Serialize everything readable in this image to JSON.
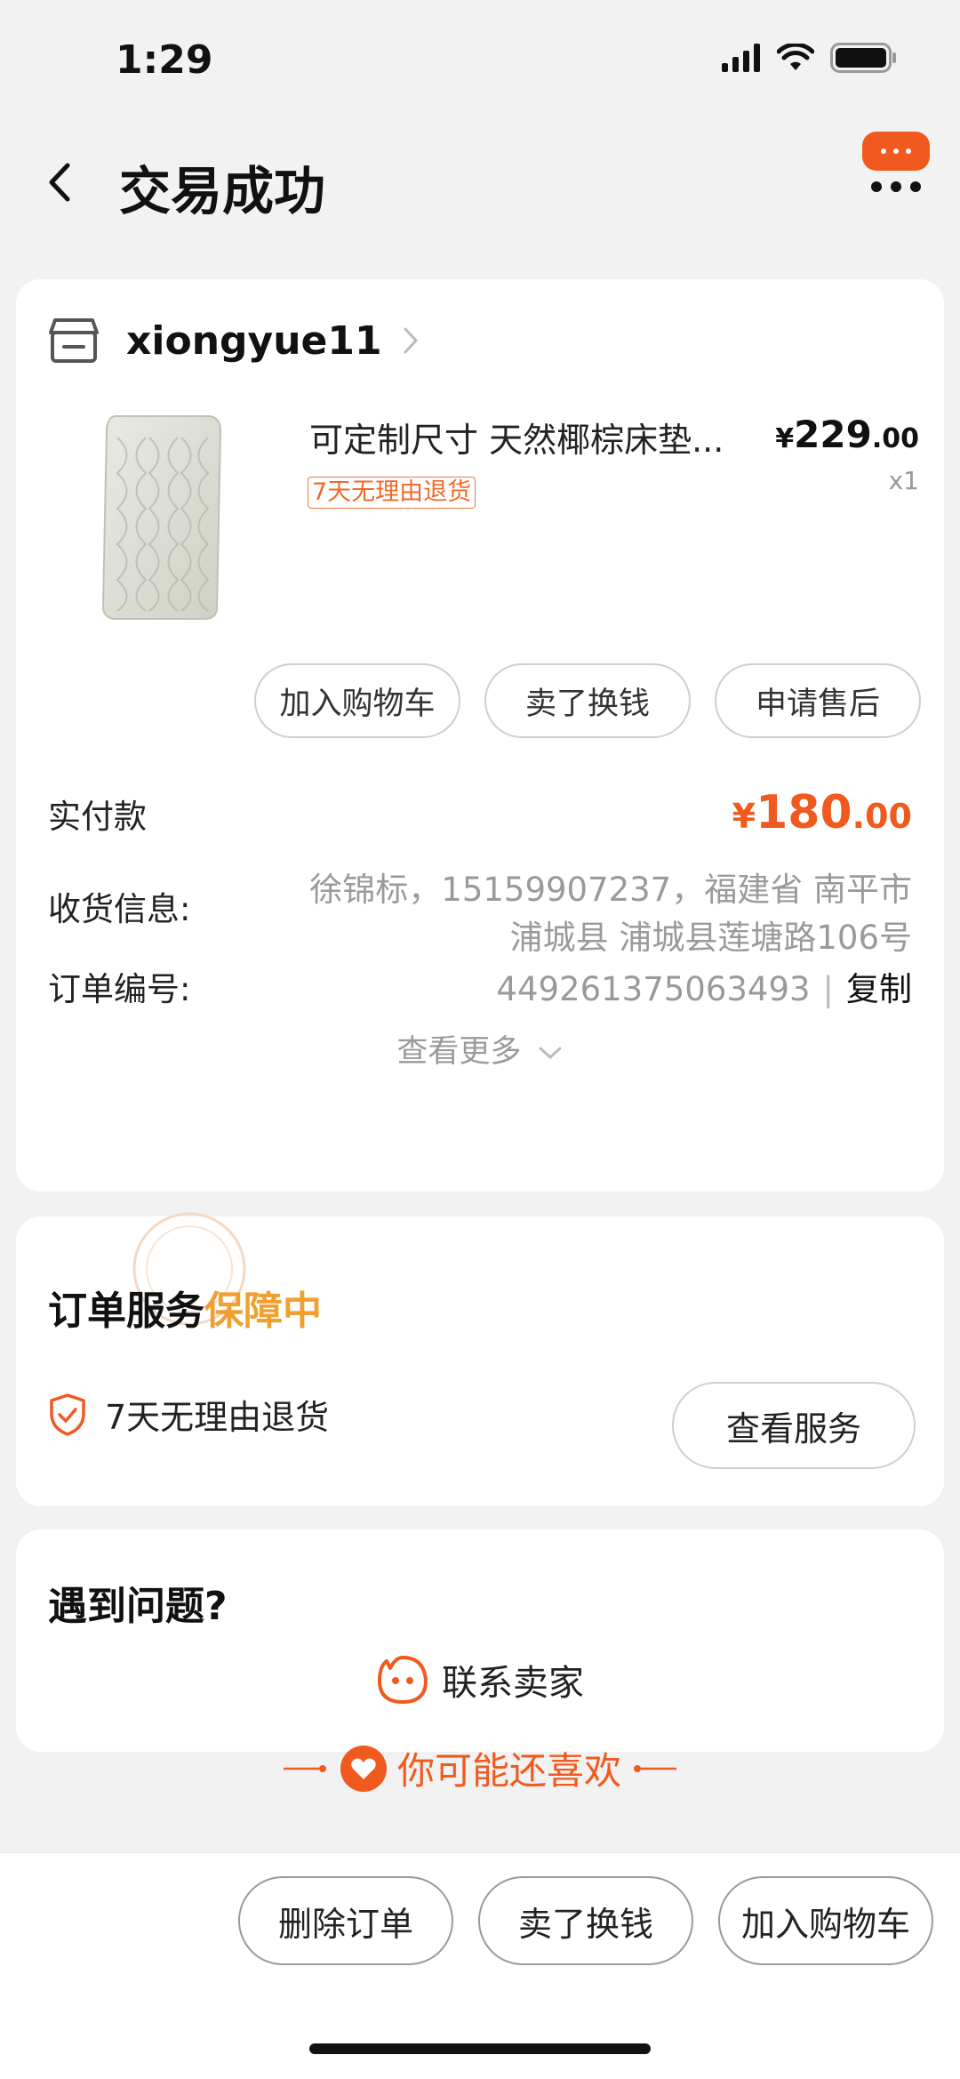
{
  "status_bar": {
    "time": "1:29"
  },
  "header": {
    "title": "交易成功"
  },
  "order": {
    "shop_name": "xiongyue11",
    "product": {
      "title": "可定制尺寸 天然椰棕床垫...",
      "price_symbol": "¥",
      "price_int": "229",
      "price_dec": ".00",
      "quantity": "x1",
      "return_tag": "7天无理由退货"
    },
    "actions": [
      "加入购物车",
      "卖了换钱",
      "申请售后"
    ],
    "paid_label": "实付款",
    "paid_symbol": "¥",
    "paid_int": "180",
    "paid_dec": ".00",
    "shipping_label": "收货信息:",
    "shipping_value": "徐锦标，15159907237，福建省 南平市 浦城县 浦城县莲塘路106号",
    "order_no_label": "订单编号:",
    "order_no": "449261375063493",
    "separator": "|",
    "copy_label": "复制",
    "more_label": "查看更多"
  },
  "service": {
    "title_prefix": "订单服务",
    "title_highlight": "保障中",
    "item": "7天无理由退货",
    "view_button": "查看服务"
  },
  "problem": {
    "title": "遇到问题?",
    "contact_label": "联系卖家"
  },
  "recommend": {
    "label": "你可能还喜欢"
  },
  "bottom_bar": {
    "buttons": [
      "删除订单",
      "卖了换钱",
      "加入购物车"
    ]
  },
  "colors": {
    "accent": "#f05a1e",
    "highlight": "#f0a030",
    "background": "#f2f2f2"
  }
}
